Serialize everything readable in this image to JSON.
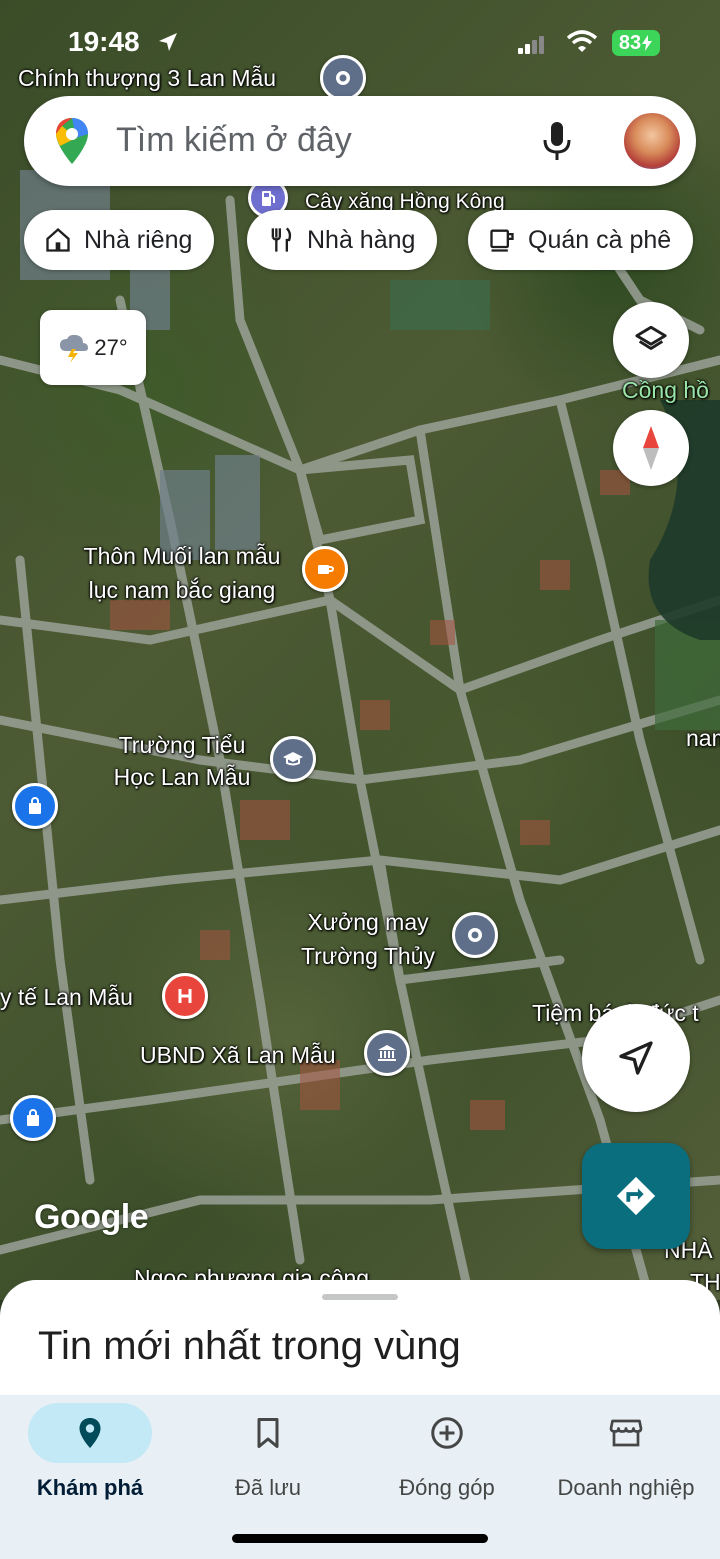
{
  "status_bar": {
    "time": "19:48",
    "battery": "83"
  },
  "search": {
    "placeholder": "Tìm kiếm ở đây"
  },
  "chips": [
    {
      "label": "Nhà riêng",
      "icon": "home-icon"
    },
    {
      "label": "Nhà hàng",
      "icon": "restaurant-icon"
    },
    {
      "label": "Quán cà phê",
      "icon": "coffee-icon"
    }
  ],
  "weather": {
    "temperature": "27°",
    "icon": "thunderstorm-icon"
  },
  "map": {
    "labels": {
      "top_road": "Chính thượng 3 Lan Mẫu",
      "gas_station": "Cây xăng Hồng Kông",
      "cong_ho": "Cồng hồ",
      "thon_muoi_1": "Thôn Muối lan mẫu",
      "thon_muoi_2": "lục nam bắc giang",
      "school_1": "Trường Tiểu",
      "school_2": "Học Lan Mẫu",
      "nam": "nam",
      "xuong_may_1": "Xưởng may",
      "xuong_may_2": "Trường Thủy",
      "y_te": "y tế Lan Mẫu",
      "ubnd": "UBND Xã Lan Mẫu",
      "tiem_banh": "Tiệm bánh đức t",
      "ngoc_phuong": "Ngọc phượng gia công",
      "nha": "NHÀ",
      "th": "TH",
      "google": "Google"
    }
  },
  "sheet": {
    "title": "Tin mới nhất trong vùng"
  },
  "nav": [
    {
      "label": "Khám phá",
      "icon": "explore-pin-icon",
      "active": true
    },
    {
      "label": "Đã lưu",
      "icon": "bookmark-icon",
      "active": false
    },
    {
      "label": "Đóng góp",
      "icon": "add-circle-icon",
      "active": false
    },
    {
      "label": "Doanh nghiệp",
      "icon": "storefront-icon",
      "active": false
    }
  ],
  "colors": {
    "accent": "#0b6e7f",
    "nav_active_bg": "#c3e8f6",
    "battery": "#3dd45a",
    "cafe_pin": "#f57c00",
    "hospital_pin": "#e8453c",
    "gov_pin": "#5f6f8a",
    "shop_pin": "#1a73e8"
  }
}
